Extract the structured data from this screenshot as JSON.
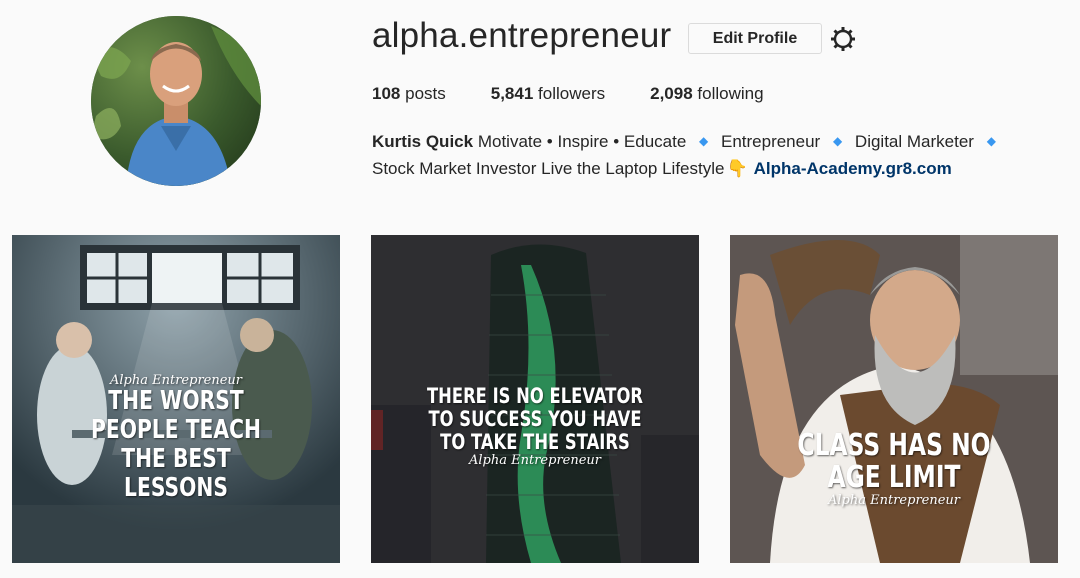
{
  "profile": {
    "username": "alpha.entrepreneur",
    "edit_label": "Edit Profile",
    "stats": [
      {
        "value": "108",
        "label": "posts"
      },
      {
        "value": "5,841",
        "label": "followers"
      },
      {
        "value": "2,098",
        "label": "following"
      }
    ],
    "bio": {
      "name": "Kurtis Quick",
      "line1_a": "Motivate • Inspire • Educate",
      "line1_b": "Entrepreneur",
      "line1_c": "Digital Marketer",
      "diamond": "◆",
      "line2": "Stock Market Investor Live the Laptop Lifestyle",
      "hand": "👇",
      "link": "Alpha-Academy.gr8.com"
    }
  },
  "posts": [
    {
      "brand": "Alpha Entrepreneur",
      "lines": [
        "THE WORST",
        "PEOPLE TEACH",
        "THE BEST",
        "LESSONS"
      ]
    },
    {
      "brand": "Alpha Entrepreneur",
      "lines": [
        "THERE IS NO ELEVATOR",
        "TO SUCCESS YOU HAVE",
        "TO TAKE THE STAIRS"
      ]
    },
    {
      "brand": "Alpha Entrepreneur",
      "lines": [
        "CLASS HAS NO",
        "AGE LIMIT"
      ]
    }
  ],
  "icons": {
    "settings": "gear-icon",
    "bio_separator": "diamond-icon",
    "bio_emoji": "pointing-down-hand-icon"
  },
  "colors": {
    "background": "#fafafa",
    "link": "#003569",
    "diamond": "#3897f0"
  }
}
